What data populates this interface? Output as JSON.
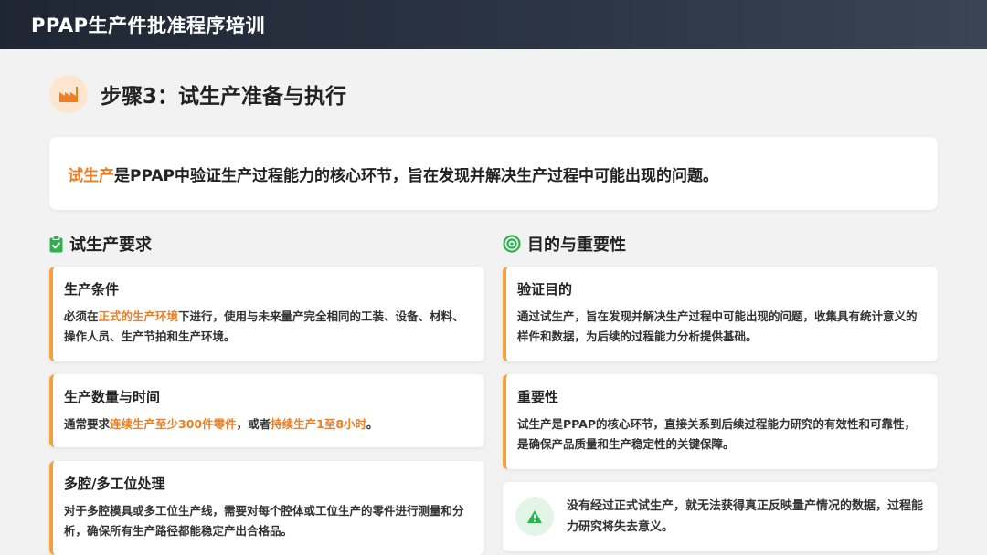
{
  "header": {
    "title": "PPAP生产件批准程序培训"
  },
  "step": {
    "title": "步骤3：试生产准备与执行",
    "icon": "factory-icon"
  },
  "intro": {
    "highlight": "试生产",
    "text": "是PPAP中验证生产过程能力的核心环节，旨在发现并解决生产过程中可能出现的问题。"
  },
  "left": {
    "heading": "试生产要求",
    "icon": "clipboard-check-icon",
    "cards": [
      {
        "title": "生产条件",
        "p1": "必须在",
        "h1": "正式的生产环境",
        "p2": "下进行，使用与未来量产完全相同的工装、设备、材料、操作人员、生产节拍和生产环境。"
      },
      {
        "title": "生产数量与时间",
        "p1": "通常要求",
        "h1": "连续生产至少300件零件",
        "p2": "，或者",
        "h2": "持续生产1至8小时",
        "p3": "。"
      },
      {
        "title": "多腔/多工位处理",
        "p1": "对于多腔模具或多工位生产线，需要对每个腔体或工位生产的零件进行测量和分析，确保所有生产路径都能稳定产出合格品。"
      }
    ]
  },
  "right": {
    "heading": "目的与重要性",
    "icon": "target-icon",
    "cards": [
      {
        "title": "验证目的",
        "text": "通过试生产，旨在发现并解决生产过程中可能出现的问题，收集具有统计意义的样件和数据，为后续的过程能力分析提供基础。"
      },
      {
        "title": "重要性",
        "text": "试生产是PPAP的核心环节，直接关系到后续过程能力研究的有效性和可靠性，是确保产品质量和生产稳定性的关键保障。"
      }
    ],
    "warning": {
      "icon": "warning-triangle-icon",
      "text": "没有经过正式试生产，就无法获得真正反映量产情况的数据，过程能力研究将失去意义。"
    }
  },
  "colors": {
    "accent": "#f07d1e",
    "border": "#f5a03a",
    "green": "#2bb24c",
    "header": "#1f2633"
  }
}
